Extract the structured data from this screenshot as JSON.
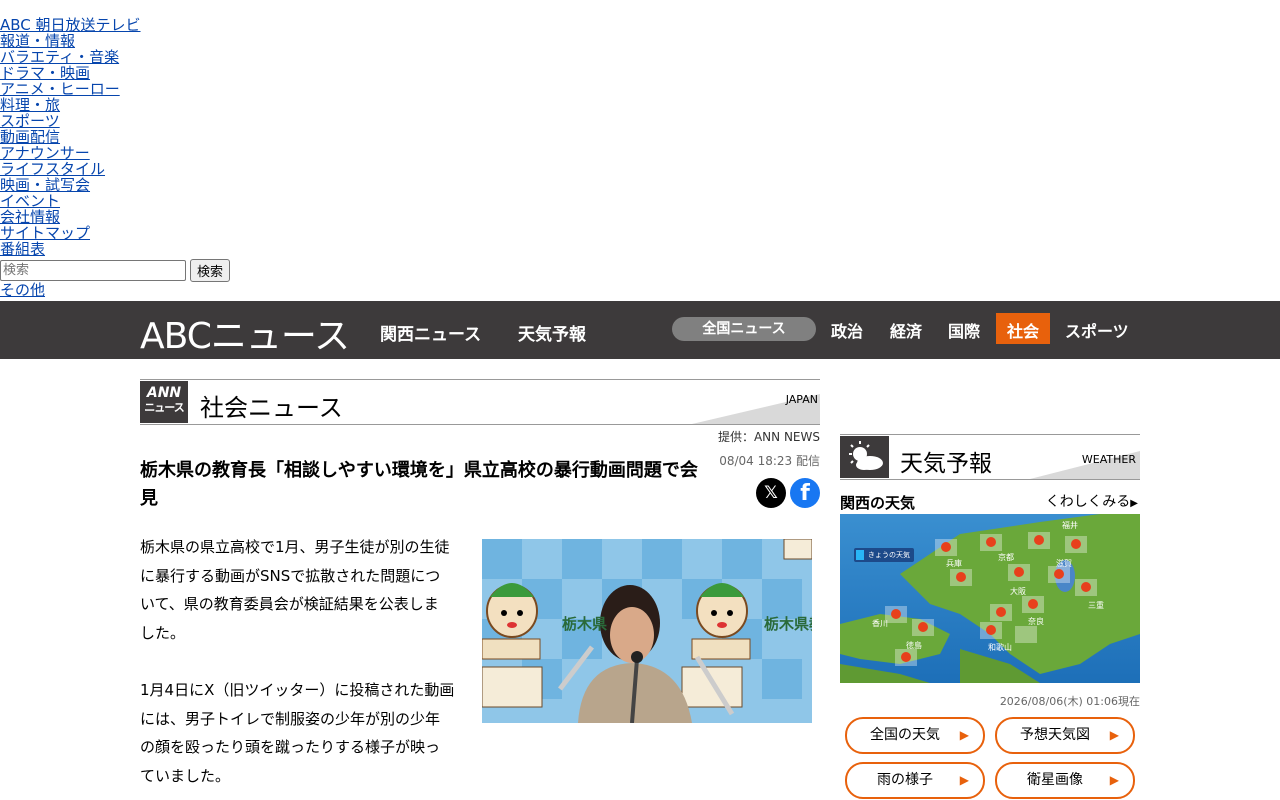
{
  "topnav": {
    "links": [
      "ABC 朝日放送テレビ",
      "報道・情報",
      "バラエティ・音楽",
      "ドラマ・映画",
      "アニメ・ヒーロー",
      "料理・旅",
      "スポーツ",
      "動画配信",
      "アナウンサー",
      "ライフスタイル",
      "映画・試写会",
      "イベント",
      "会社情報",
      "サイトマップ",
      "番組表"
    ],
    "search_placeholder": "検索",
    "search_button": "検索",
    "other": "その他"
  },
  "header": {
    "logo": "ABCニュース",
    "nav": [
      "関西ニュース",
      "天気予報"
    ],
    "national_pill": "全国ニュース",
    "categories": [
      "政治",
      "経済",
      "国際",
      "社会",
      "スポーツ"
    ],
    "active_category": "社会",
    "colors": {
      "bar": "#3d3a3b",
      "accent": "#e8610c",
      "pill": "#808080"
    }
  },
  "section": {
    "badge_top": "ANN",
    "badge_bottom": "ニュース",
    "title": "社会ニュース",
    "label_en": "JAPAN"
  },
  "article": {
    "provider": "提供：ANN NEWS",
    "date": "08/04 18:23 配信",
    "headline": "栃木県の教育長「相談しやすい環境を」県立高校の暴行動画問題で会見",
    "paragraph1_lines": [
      "栃木県の県立高校で1月、男子生徒が別の生徒",
      "に暴行する動画がSNSで拡散された問題につ",
      "いて、県の教育委員会が検証結果を公表しま",
      "した。"
    ],
    "paragraph2_lines": [
      "1月4日にX（旧ツイッター）に投稿された動画",
      "には、男子トイレで制服姿の少年が別の少年",
      "の顔を殴ったり頭を蹴ったりする様子が映っ",
      "ていました。"
    ],
    "image_text_left": "栃木県",
    "image_text_right": "栃木県教",
    "share_x": "𝕏",
    "share_fb": "f"
  },
  "weather": {
    "title": "天気予報",
    "label_en": "WEATHER",
    "region_label": "関西の天気",
    "more_link": "くわしくみる",
    "map_badge": "きょうの天気",
    "cities": [
      "福井",
      "兵庫",
      "京都",
      "滋賀",
      "大阪",
      "三重",
      "香川",
      "奈良",
      "徳島",
      "和歌山"
    ],
    "timestamp": "2026/08/06(木) 01:06現在",
    "buttons": [
      "全国の天気",
      "予想天気図",
      "雨の様子",
      "衛星画像"
    ]
  }
}
